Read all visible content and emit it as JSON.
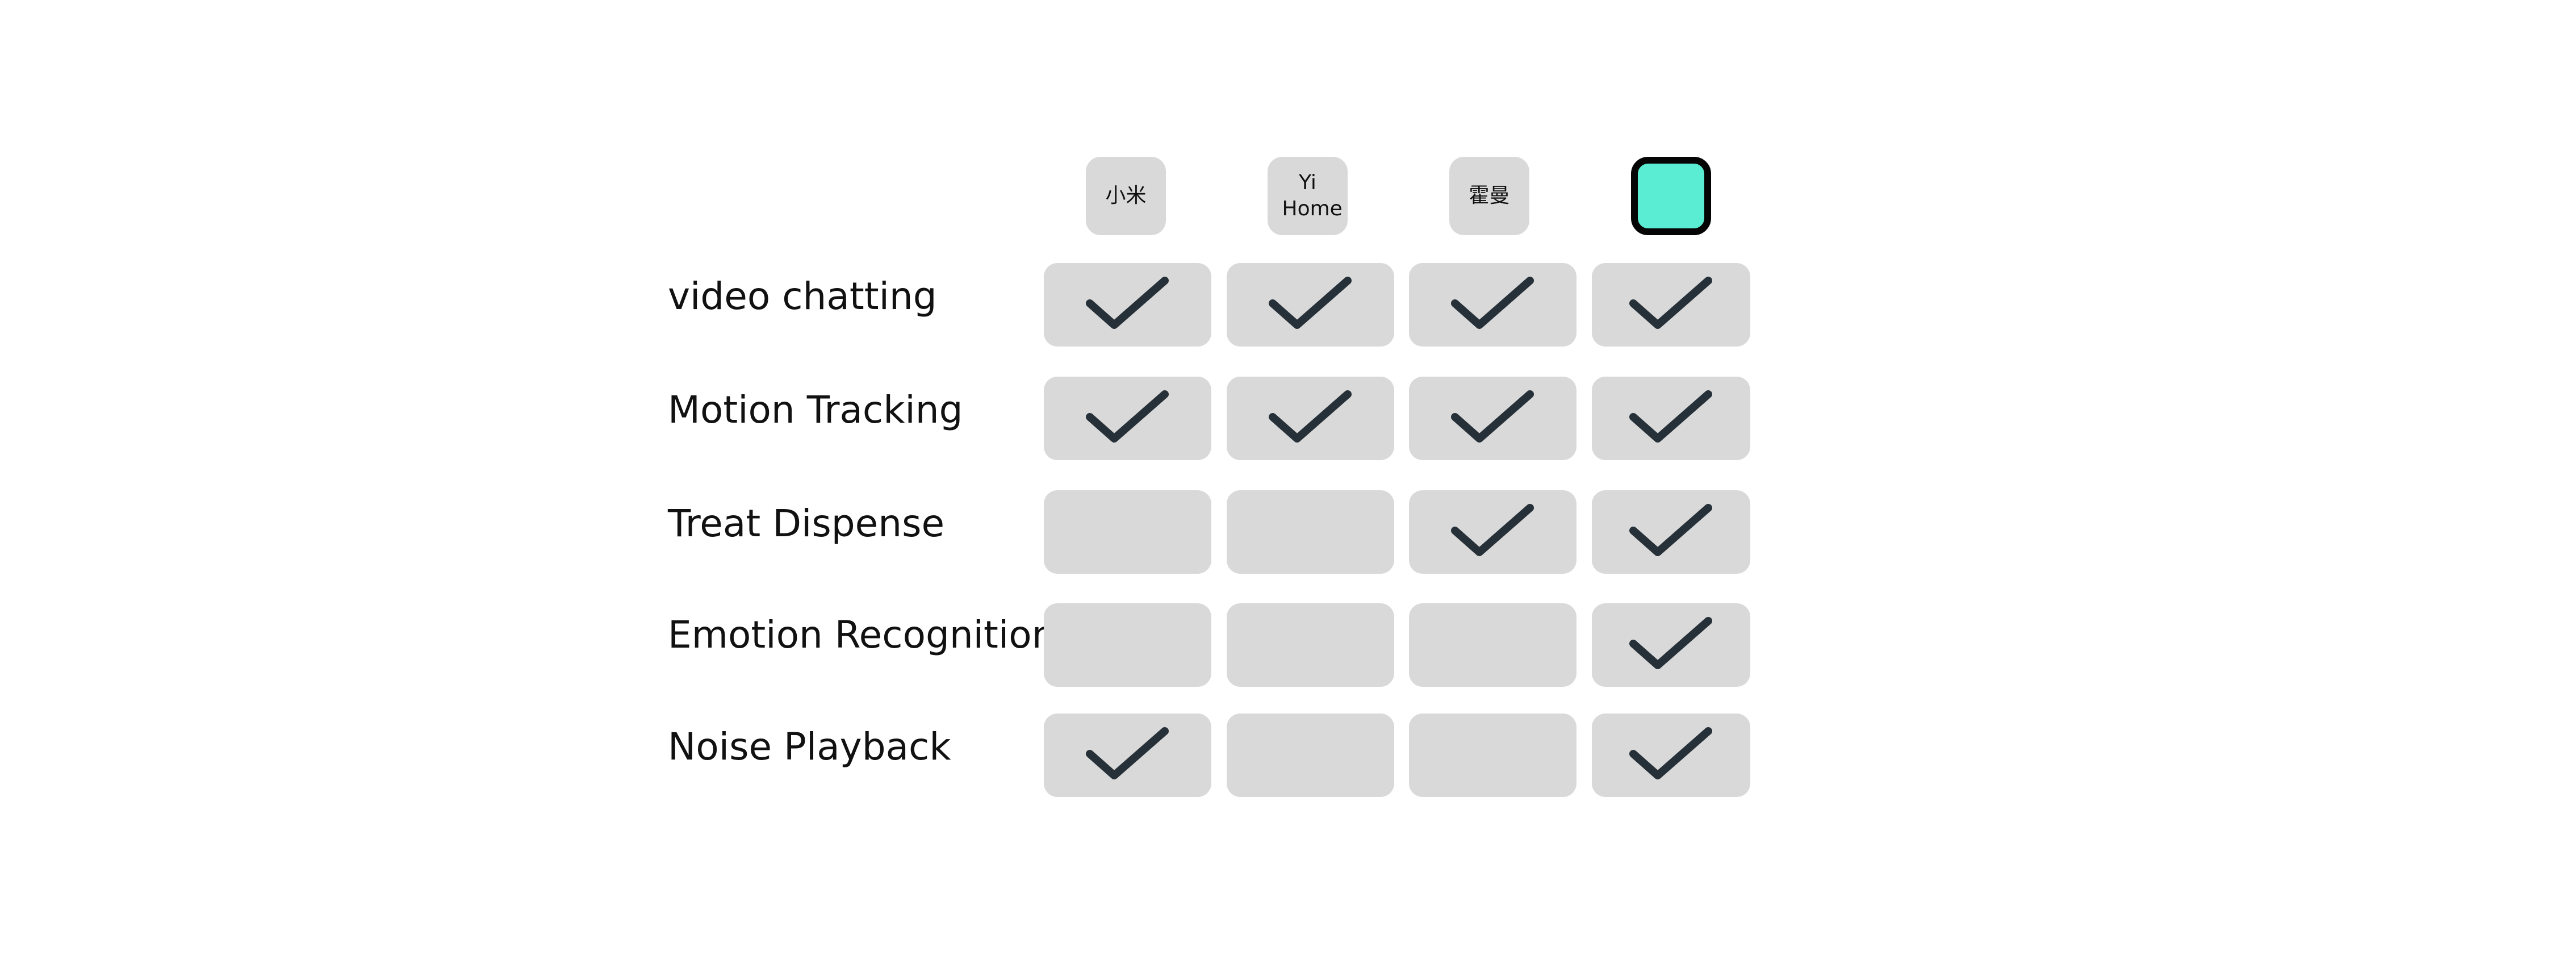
{
  "brands": [
    {
      "name": "小米"
    },
    {
      "name": "Yi Home"
    },
    {
      "name": "霍曼"
    },
    {
      "name": ""
    }
  ],
  "colors": {
    "cell_background": "#d9d9d9",
    "check": "#263038",
    "highlight_brand_fill": "#5aedd3",
    "highlight_brand_border": "#050505",
    "label_text": "#111111"
  },
  "features": [
    {
      "label": "video chatting",
      "supported": [
        true,
        true,
        true,
        true
      ]
    },
    {
      "label": "Motion Tracking",
      "supported": [
        true,
        true,
        true,
        true
      ]
    },
    {
      "label": "Treat Dispense",
      "supported": [
        false,
        false,
        true,
        true
      ]
    },
    {
      "label": "Emotion Recognition",
      "supported": [
        false,
        false,
        false,
        true
      ]
    },
    {
      "label": "Noise Playback",
      "supported": [
        true,
        false,
        false,
        true
      ]
    }
  ]
}
